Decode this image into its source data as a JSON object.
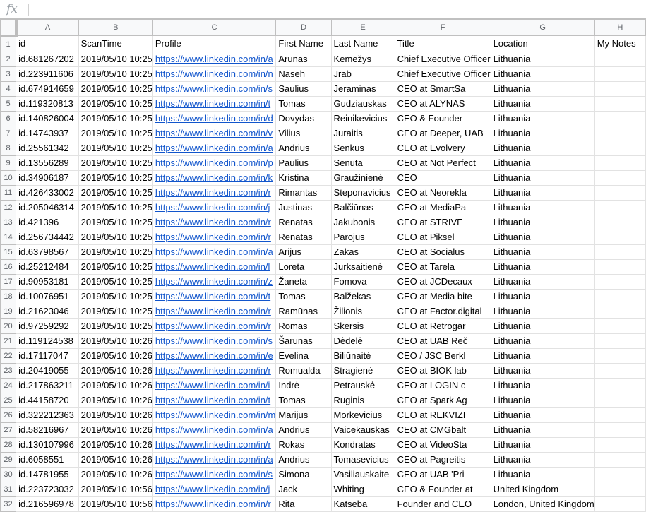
{
  "formula_bar": {
    "fx_label": "fx",
    "value": ""
  },
  "columns": [
    "A",
    "B",
    "C",
    "D",
    "E",
    "F",
    "G",
    "H"
  ],
  "header_row": [
    "id",
    "ScanTime",
    "Profile",
    "First Name",
    "Last Name",
    "Title",
    "Location",
    "My Notes"
  ],
  "rows": [
    [
      "id.681267202",
      "2019/05/10 10:25",
      "https://www.linkedin.com/in/a",
      "Arūnas",
      "Kemežys",
      "Chief Executive Officer",
      "Lithuania",
      ""
    ],
    [
      "id.223911606",
      "2019/05/10 10:25",
      "https://www.linkedin.com/in/n",
      "Naseh",
      "Jrab",
      "Chief Executive Officer",
      "Lithuania",
      ""
    ],
    [
      "id.674914659",
      "2019/05/10 10:25",
      "https://www.linkedin.com/in/s",
      "Saulius",
      "Jeraminas",
      "CEO at SmartSa",
      "Lithuania",
      ""
    ],
    [
      "id.119320813",
      "2019/05/10 10:25",
      "https://www.linkedin.com/in/t",
      "Tomas",
      "Gudziauskas",
      "CEO at ALYNAS",
      "Lithuania",
      ""
    ],
    [
      "id.140826004",
      "2019/05/10 10:25",
      "https://www.linkedin.com/in/d",
      "Dovydas",
      "Reinikevicius",
      "CEO & Founder",
      "Lithuania",
      ""
    ],
    [
      "id.14743937",
      "2019/05/10 10:25",
      "https://www.linkedin.com/in/v",
      "Vilius",
      "Juraitis",
      "CEO at Deeper, UAB",
      "Lithuania",
      ""
    ],
    [
      "id.25561342",
      "2019/05/10 10:25",
      "https://www.linkedin.com/in/a",
      "Andrius",
      "Senkus",
      "CEO at Evolvery",
      "Lithuania",
      ""
    ],
    [
      "id.13556289",
      "2019/05/10 10:25",
      "https://www.linkedin.com/in/p",
      "Paulius",
      "Senuta",
      "CEO at Not Perfect",
      "Lithuania",
      ""
    ],
    [
      "id.34906187",
      "2019/05/10 10:25",
      "https://www.linkedin.com/in/k",
      "Kristina",
      "Graužinienė",
      "CEO",
      "Lithuania",
      ""
    ],
    [
      "id.426433002",
      "2019/05/10 10:25",
      "https://www.linkedin.com/in/r",
      "Rimantas",
      "Steponavicius",
      "CEO at Neorekla",
      "Lithuania",
      ""
    ],
    [
      "id.205046314",
      "2019/05/10 10:25",
      "https://www.linkedin.com/in/j",
      "Justinas",
      "Balčiūnas",
      "CEO at MediaPa",
      "Lithuania",
      ""
    ],
    [
      "id.421396",
      "2019/05/10 10:25",
      "https://www.linkedin.com/in/r",
      "Renatas",
      "Jakubonis",
      "CEO at STRIVE",
      "Lithuania",
      ""
    ],
    [
      "id.256734442",
      "2019/05/10 10:25",
      "https://www.linkedin.com/in/r",
      "Renatas",
      "Parojus",
      "CEO at Piksel",
      "Lithuania",
      ""
    ],
    [
      "id.63798567",
      "2019/05/10 10:25",
      "https://www.linkedin.com/in/a",
      "Arijus",
      "Zakas",
      "CEO at Socialus",
      "Lithuania",
      ""
    ],
    [
      "id.25212484",
      "2019/05/10 10:25",
      "https://www.linkedin.com/in/l",
      "Loreta",
      "Jurksaitienė",
      "CEO at Tarela",
      "Lithuania",
      ""
    ],
    [
      "id.90953181",
      "2019/05/10 10:25",
      "https://www.linkedin.com/in/z",
      "Žaneta",
      "Fomova",
      "CEO at JCDecaux",
      "Lithuania",
      ""
    ],
    [
      "id.10076951",
      "2019/05/10 10:25",
      "https://www.linkedin.com/in/t",
      "Tomas",
      "Balžekas",
      "CEO at Media bite",
      "Lithuania",
      ""
    ],
    [
      "id.21623046",
      "2019/05/10 10:25",
      "https://www.linkedin.com/in/r",
      "Ramūnas",
      "Žilionis",
      "CEO at Factor.digital",
      "Lithuania",
      ""
    ],
    [
      "id.97259292",
      "2019/05/10 10:25",
      "https://www.linkedin.com/in/r",
      "Romas",
      "Skersis",
      "CEO at Retrogar",
      "Lithuania",
      ""
    ],
    [
      "id.119124538",
      "2019/05/10 10:26",
      "https://www.linkedin.com/in/s",
      "Šarūnas",
      "Dėdelė",
      "CEO at UAB Reč",
      "Lithuania",
      ""
    ],
    [
      "id.17117047",
      "2019/05/10 10:26",
      "https://www.linkedin.com/in/e",
      "Evelina",
      "Biliūnaitė",
      "CEO / JSC Berkl",
      "Lithuania",
      ""
    ],
    [
      "id.20419055",
      "2019/05/10 10:26",
      "https://www.linkedin.com/in/r",
      "Romualda",
      "Stragienė",
      "CEO at BIOK lab",
      "Lithuania",
      ""
    ],
    [
      "id.217863211",
      "2019/05/10 10:26",
      "https://www.linkedin.com/in/i",
      "Indrė",
      "Petrauskė",
      "CEO at LOGIN c",
      "Lithuania",
      ""
    ],
    [
      "id.44158720",
      "2019/05/10 10:26",
      "https://www.linkedin.com/in/t",
      "Tomas",
      "Ruginis",
      "CEO at Spark Ag",
      "Lithuania",
      ""
    ],
    [
      "id.322212363",
      "2019/05/10 10:26",
      "https://www.linkedin.com/in/m",
      "Marijus",
      "Morkevicius",
      "CEO at REKVIZI",
      "Lithuania",
      ""
    ],
    [
      "id.58216967",
      "2019/05/10 10:26",
      "https://www.linkedin.com/in/a",
      "Andrius",
      "Vaicekauskas",
      "CEO at CMGbalt",
      "Lithuania",
      ""
    ],
    [
      "id.130107996",
      "2019/05/10 10:26",
      "https://www.linkedin.com/in/r",
      "Rokas",
      "Kondratas",
      "CEO at VideoSta",
      "Lithuania",
      ""
    ],
    [
      "id.6058551",
      "2019/05/10 10:26",
      "https://www.linkedin.com/in/a",
      "Andrius",
      "Tomasevicius",
      "CEO at Pagreitis",
      "Lithuania",
      ""
    ],
    [
      "id.14781955",
      "2019/05/10 10:26",
      "https://www.linkedin.com/in/s",
      "Simona",
      "Vasiliauskaite",
      "CEO at UAB 'Pri",
      "Lithuania",
      ""
    ],
    [
      "id.223723032",
      "2019/05/10 10:56",
      "https://www.linkedin.com/in/j",
      "Jack",
      "Whiting",
      "CEO & Founder at",
      "United Kingdom",
      ""
    ],
    [
      "id.216596978",
      "2019/05/10 10:56",
      "https://www.linkedin.com/in/r",
      "Rita",
      "Katseba",
      "Founder and CEO",
      "London, United Kingdom",
      ""
    ]
  ],
  "colors": {
    "link": "#1155cc",
    "header_bg": "#f8f9fa",
    "grid_line": "#e2e2e2"
  }
}
